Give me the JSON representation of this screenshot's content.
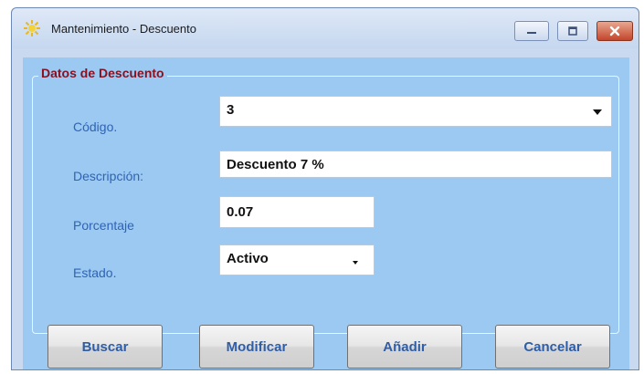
{
  "window": {
    "title": "Mantenimiento - Descuento"
  },
  "group": {
    "title": "Datos de Descuento"
  },
  "form": {
    "codigo": {
      "label": "Código.",
      "value": "3"
    },
    "descripcion": {
      "label": "Descripción:",
      "value": "Descuento 7 %"
    },
    "porcentaje": {
      "label": "Porcentaje",
      "value": "0.07"
    },
    "estado": {
      "label": "Estado.",
      "value": "Activo"
    }
  },
  "buttons": {
    "buscar": "Buscar",
    "modificar": "Modificar",
    "anadir": "Añadir",
    "cancelar": "Cancelar"
  },
  "icons": {
    "app": "app-icon",
    "minimize": "minimize-icon",
    "maximize": "maximize-icon",
    "close": "close-icon"
  },
  "colors": {
    "client_background": "#9bc9f1",
    "group_title": "#8a1020",
    "label_text": "#2f63b8",
    "button_text": "#2f5da6",
    "close_button": "#c3462c"
  }
}
